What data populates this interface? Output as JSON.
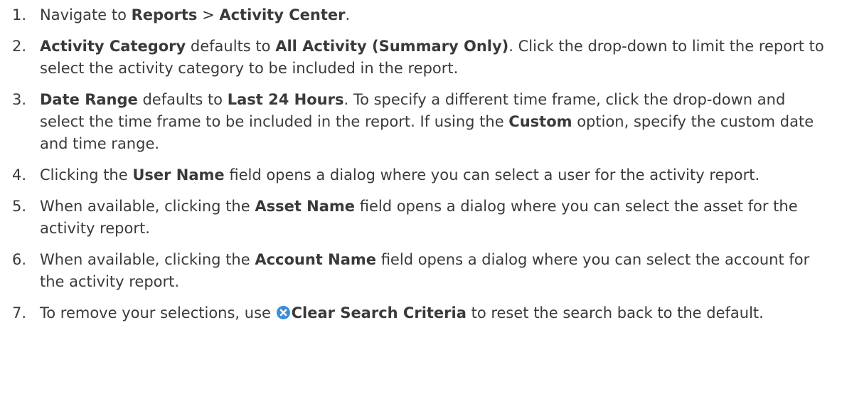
{
  "steps": [
    {
      "num": "1.",
      "parts": [
        {
          "t": "Navigate to ",
          "b": false
        },
        {
          "t": "Reports",
          "b": true
        },
        {
          "t": " > ",
          "b": false
        },
        {
          "t": "Activity Center",
          "b": true
        },
        {
          "t": ".",
          "b": false
        }
      ]
    },
    {
      "num": "2.",
      "parts": [
        {
          "t": "Activity Category",
          "b": true
        },
        {
          "t": " defaults to ",
          "b": false
        },
        {
          "t": "All Activity (Summary Only)",
          "b": true
        },
        {
          "t": ". Click the drop-down to limit the report to select the activity category to be included in the report.",
          "b": false
        }
      ]
    },
    {
      "num": "3.",
      "parts": [
        {
          "t": "Date Range",
          "b": true
        },
        {
          "t": " defaults to ",
          "b": false
        },
        {
          "t": "Last 24 Hours",
          "b": true
        },
        {
          "t": ". To specify a different time frame, click the drop-down and select the time frame to be included in the report. If using the ",
          "b": false
        },
        {
          "t": "Custom",
          "b": true
        },
        {
          "t": " option, specify the custom date and time range.",
          "b": false
        }
      ]
    },
    {
      "num": "4.",
      "parts": [
        {
          "t": "Clicking the ",
          "b": false
        },
        {
          "t": "User Name",
          "b": true
        },
        {
          "t": " field opens a dialog where you can select a user for the activity report.",
          "b": false
        }
      ]
    },
    {
      "num": "5.",
      "parts": [
        {
          "t": "When available, clicking the ",
          "b": false
        },
        {
          "t": "Asset Name",
          "b": true
        },
        {
          "t": " field opens a dialog where you can select the asset for the activity report.",
          "b": false
        }
      ]
    },
    {
      "num": "6.",
      "parts": [
        {
          "t": "When available, clicking the ",
          "b": false
        },
        {
          "t": "Account Name",
          "b": true
        },
        {
          "t": " field opens a dialog where you can select the account for the activity report.",
          "b": false
        }
      ]
    },
    {
      "num": "7.",
      "parts": [
        {
          "t": "To remove your selections, use ",
          "b": false
        },
        {
          "icon": "clear-search-icon"
        },
        {
          "t": "Clear Search Criteria",
          "b": true
        },
        {
          "t": " to reset the search back to the default.",
          "b": false
        }
      ]
    }
  ],
  "colors": {
    "text": "#3a3a3a",
    "icon": "#3b8fd6"
  }
}
